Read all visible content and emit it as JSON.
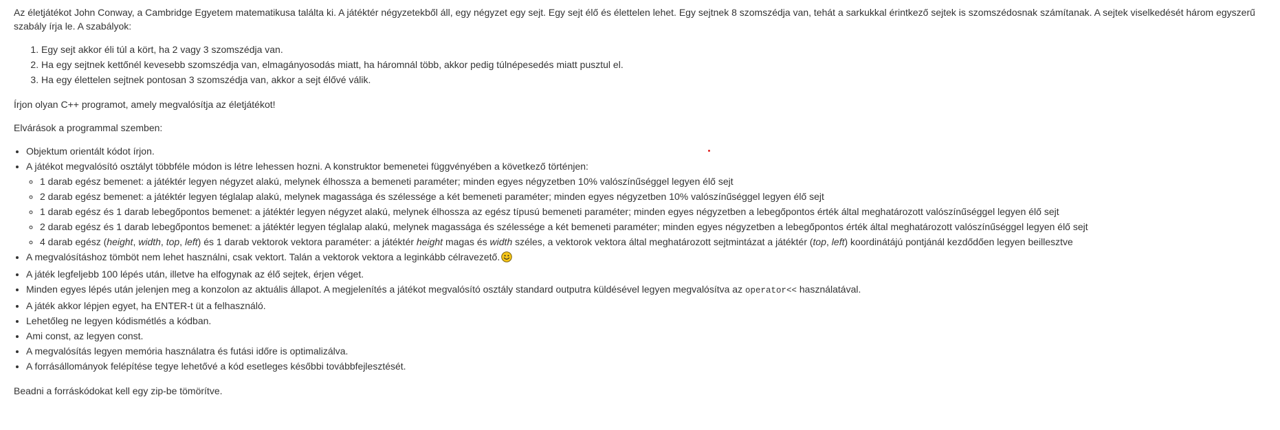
{
  "intro": {
    "text": "Az életjátékot John Conway, a Cambridge Egyetem matematikusa találta ki. A játéktér négyzetekből áll, egy négyzet egy sejt. Egy sejt élő és élettelen lehet. Egy sejtnek 8 szomszédja van, tehát a sarkukkal érintkező sejtek is szomszédosnak számítanak. A sejtek viselkedését három egyszerű szabály írja le. A szabályok:"
  },
  "rules": [
    "Egy sejt akkor éli túl a kört, ha 2 vagy 3 szomszédja van.",
    "Ha egy sejtnek kettőnél kevesebb szomszédja van, elmagányosodás miatt, ha háromnál több, akkor pedig túlnépesedés miatt pusztul el.",
    "Ha egy élettelen sejtnek pontosan 3 szomszédja van, akkor a sejt élővé válik."
  ],
  "task": "Írjon olyan C++ programot, amely megvalósítja az életjátékot!",
  "requirements_title": "Elvárások a programmal szemben:",
  "requirements": {
    "oop": "Objektum orientált kódot írjon.",
    "constructor_intro": "A játékot megvalósító osztályt többféle módon is létre lehessen hozni. A konstruktor bemenetei függvényében a következő történjen:",
    "constructor_cases": [
      "1 darab egész bemenet: a játéktér legyen négyzet alakú, melynek élhossza a bemeneti paraméter; minden egyes négyzetben 10% valószínűséggel legyen élő sejt",
      "2 darab egész bemenet: a játéktér legyen téglalap alakú, melynek magassága és szélessége a két bemeneti paraméter; minden egyes négyzetben 10% valószínűséggel legyen élő sejt",
      "1 darab egész és 1 darab lebegőpontos bemenet: a játéktér legyen négyzet alakú, melynek élhossza az egész típusú bemeneti paraméter; minden egyes négyzetben a lebegőpontos érték által meghatározott valószínűséggel legyen élő sejt",
      "2 darab egész és 1 darab lebegőpontos bemenet: a játéktér legyen téglalap alakú, melynek magassága és szélessége a két bemeneti paraméter; minden egyes négyzetben a lebegőpontos érték által meghatározott valószínűséggel legyen élő sejt"
    ],
    "case5": {
      "t1": "4 darab egész (",
      "i1": "height",
      "t2": ", ",
      "i2": "width",
      "t3": ", ",
      "i3": "top",
      "t4": ", ",
      "i4": "left",
      "t5": ") és 1 darab vektorok vektora paraméter: a játéktér ",
      "i5": "height",
      "t6": " magas és ",
      "i6": "width",
      "t7": " széles, a vektorok vektora által meghatározott sejtmintázat a játéktér (",
      "i7": "top",
      "t8": ", ",
      "i8": "left",
      "t9": ") koordinátájú pontjánál kezdődően legyen beillesztve"
    },
    "vector": "A megvalósításhoz tömböt nem lehet használni, csak vektort. Talán a vektorok vektora a leginkább célravezető.",
    "steps": "A játék legfeljebb 100 lépés után, illetve ha elfogynak az élő sejtek, érjen véget.",
    "display_before": "Minden egyes lépés után jelenjen meg a konzolon az aktuális állapot. A megjelenítés a játékot megvalósító osztály standard outputra küldésével legyen megvalósítva az ",
    "display_code": "operator<<",
    "display_after": " használatával.",
    "enter": "A játék akkor lépjen egyet, ha ENTER-t üt a felhasználó.",
    "no_repeat": "Lehetőleg ne legyen kódismétlés a kódban.",
    "const": "Ami const, az legyen const.",
    "optimize": "A megvalósítás legyen memória használatra és futási időre is optimalizálva.",
    "structure": "A forrásállományok felépítése tegye lehetővé a kód esetleges későbbi továbbfejlesztését."
  },
  "submission": "Beadni a forráskódokat kell egy zip-be tömörítve.",
  "icons": {
    "smiley": "smiley-face-icon",
    "smiley_color": "#f5c518"
  }
}
